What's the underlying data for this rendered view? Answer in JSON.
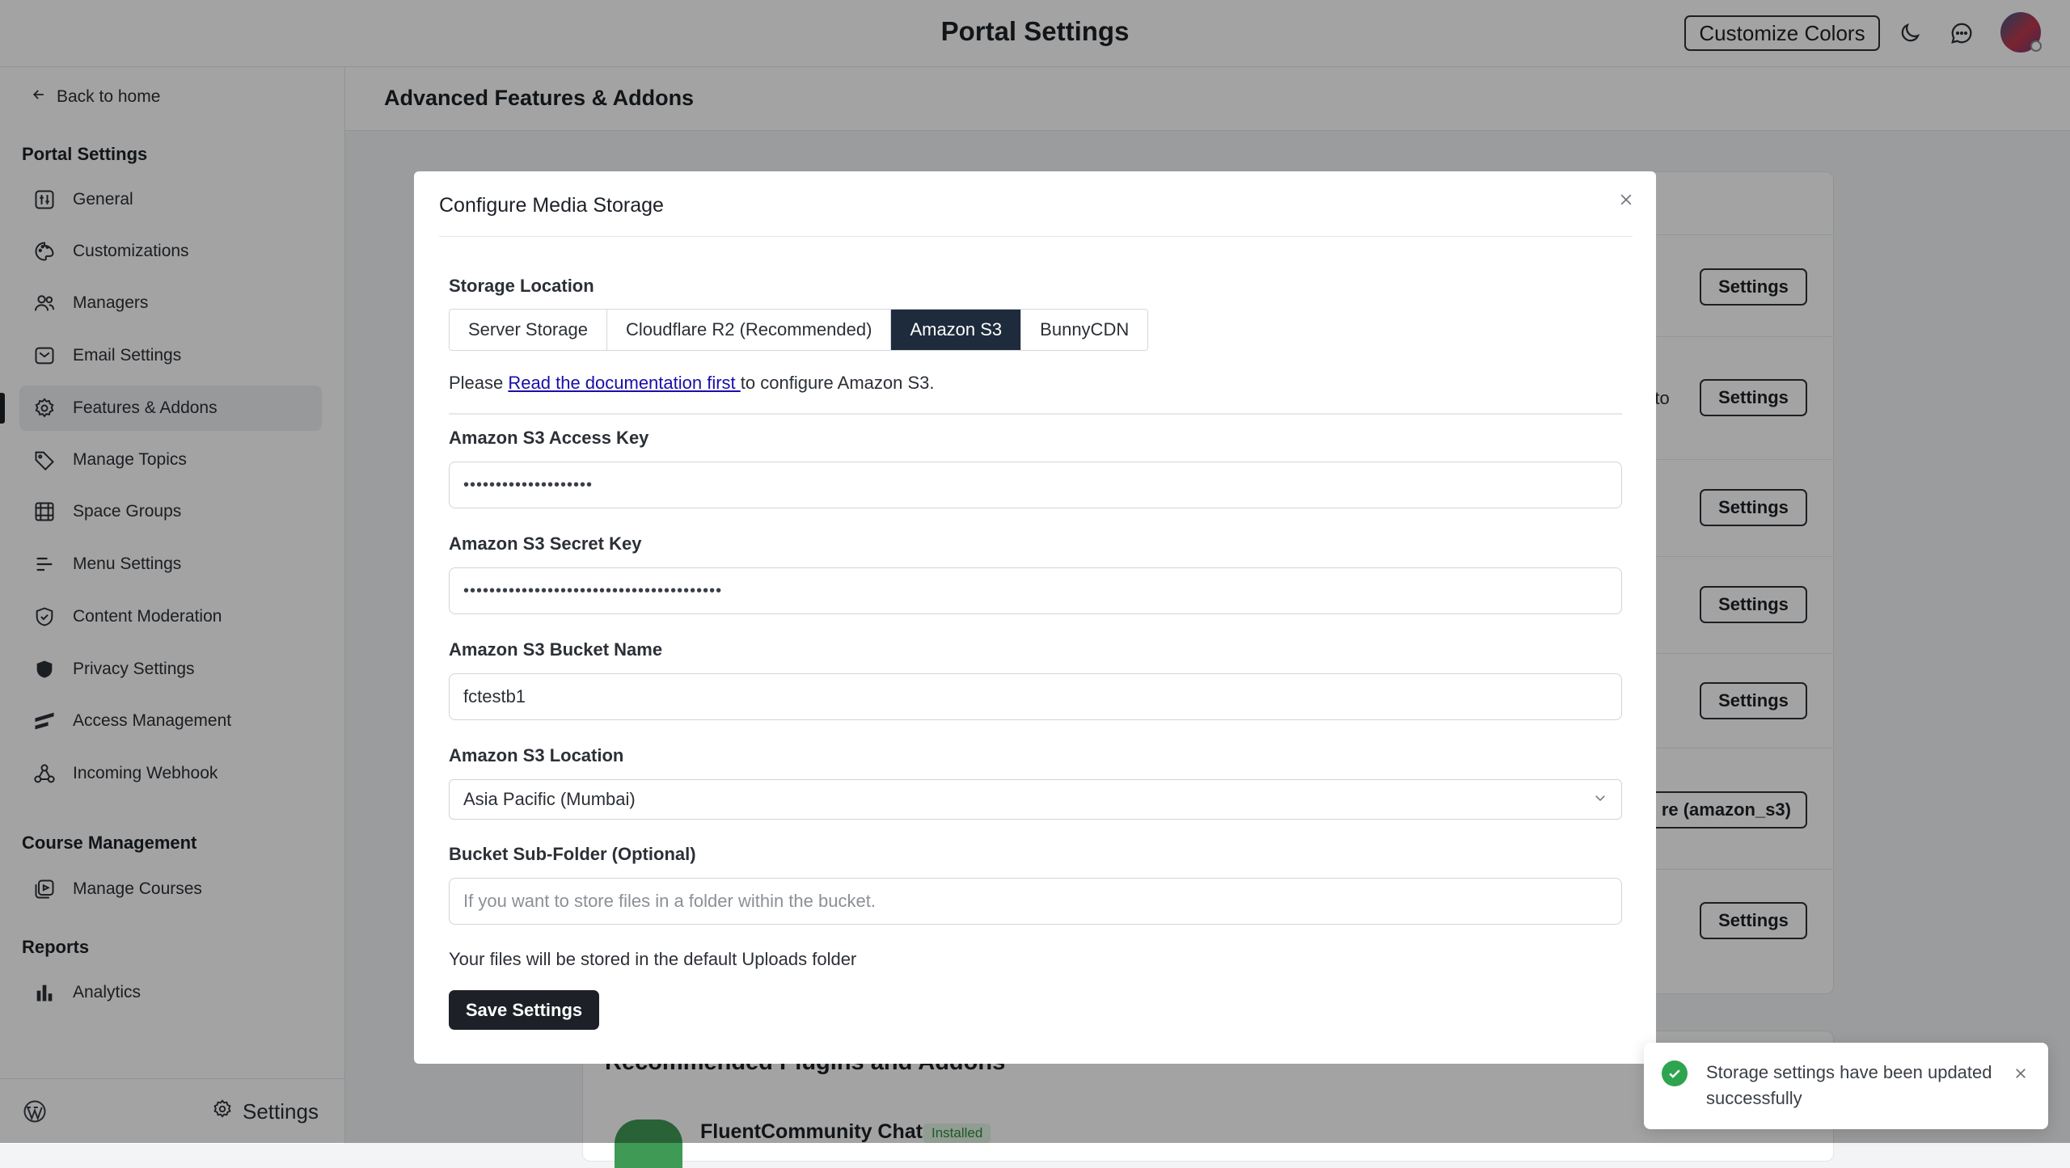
{
  "header": {
    "title": "Portal Settings",
    "customize_label": "Customize Colors",
    "icons": [
      "moon-icon",
      "chat-icon"
    ]
  },
  "sidebar": {
    "back_label": "Back to home",
    "portal_section": "Portal Settings",
    "items": [
      {
        "label": "General",
        "icon": "general-icon"
      },
      {
        "label": "Customizations",
        "icon": "palette-icon"
      },
      {
        "label": "Managers",
        "icon": "users-icon"
      },
      {
        "label": "Email Settings",
        "icon": "mail-icon"
      },
      {
        "label": "Features & Addons",
        "icon": "gear-icon",
        "active": true
      },
      {
        "label": "Manage Topics",
        "icon": "tag-icon"
      },
      {
        "label": "Space Groups",
        "icon": "groups-icon"
      },
      {
        "label": "Menu Settings",
        "icon": "menu-icon"
      },
      {
        "label": "Content Moderation",
        "icon": "shield-check-icon"
      },
      {
        "label": "Privacy Settings",
        "icon": "shield-icon"
      },
      {
        "label": "Access Management",
        "icon": "access-icon"
      },
      {
        "label": "Incoming Webhook",
        "icon": "webhook-icon"
      }
    ],
    "course_section": "Course Management",
    "course_items": [
      {
        "label": "Manage Courses",
        "icon": "courses-icon"
      }
    ],
    "reports_section": "Reports",
    "report_items": [
      {
        "label": "Analytics",
        "icon": "bar-chart-icon"
      }
    ],
    "footer_settings": "Settings"
  },
  "main": {
    "title": "Advanced Features & Addons",
    "settings_label": "Settings",
    "partial_text": "n to",
    "partial_button": "re (amazon_s3)",
    "recommended_title": "Recommended Plugins and Addons",
    "plugin_name": "FluentCommunity Chat",
    "plugin_badge": "Installed"
  },
  "modal": {
    "title": "Configure Media Storage",
    "storage_location_label": "Storage Location",
    "storage_options": [
      "Server Storage",
      "Cloudflare R2 (Recommended)",
      "Amazon S3",
      "BunnyCDN"
    ],
    "storage_selected": "Amazon S3",
    "doc_prefix": "Please ",
    "doc_link": "Read the documentation first ",
    "doc_suffix": "to configure Amazon S3.",
    "access_key_label": "Amazon S3 Access Key",
    "access_key_value": "••••••••••••••••••••",
    "secret_key_label": "Amazon S3 Secret Key",
    "secret_key_value": "••••••••••••••••••••••••••••••••••••••••",
    "bucket_label": "Amazon S3 Bucket Name",
    "bucket_value": "fctestb1",
    "location_label": "Amazon S3 Location",
    "location_value": "Asia Pacific (Mumbai)",
    "subfolder_label": "Bucket Sub-Folder (Optional)",
    "subfolder_placeholder": "If you want to store files in a folder within the bucket.",
    "hint": "Your files will be stored in the default Uploads folder",
    "save_label": "Save Settings"
  },
  "toast": {
    "message": "Storage settings have been updated successfully"
  },
  "colors": {
    "accent": "#1d2b3c",
    "success": "#2ea44f",
    "link": "#1a0dab"
  }
}
